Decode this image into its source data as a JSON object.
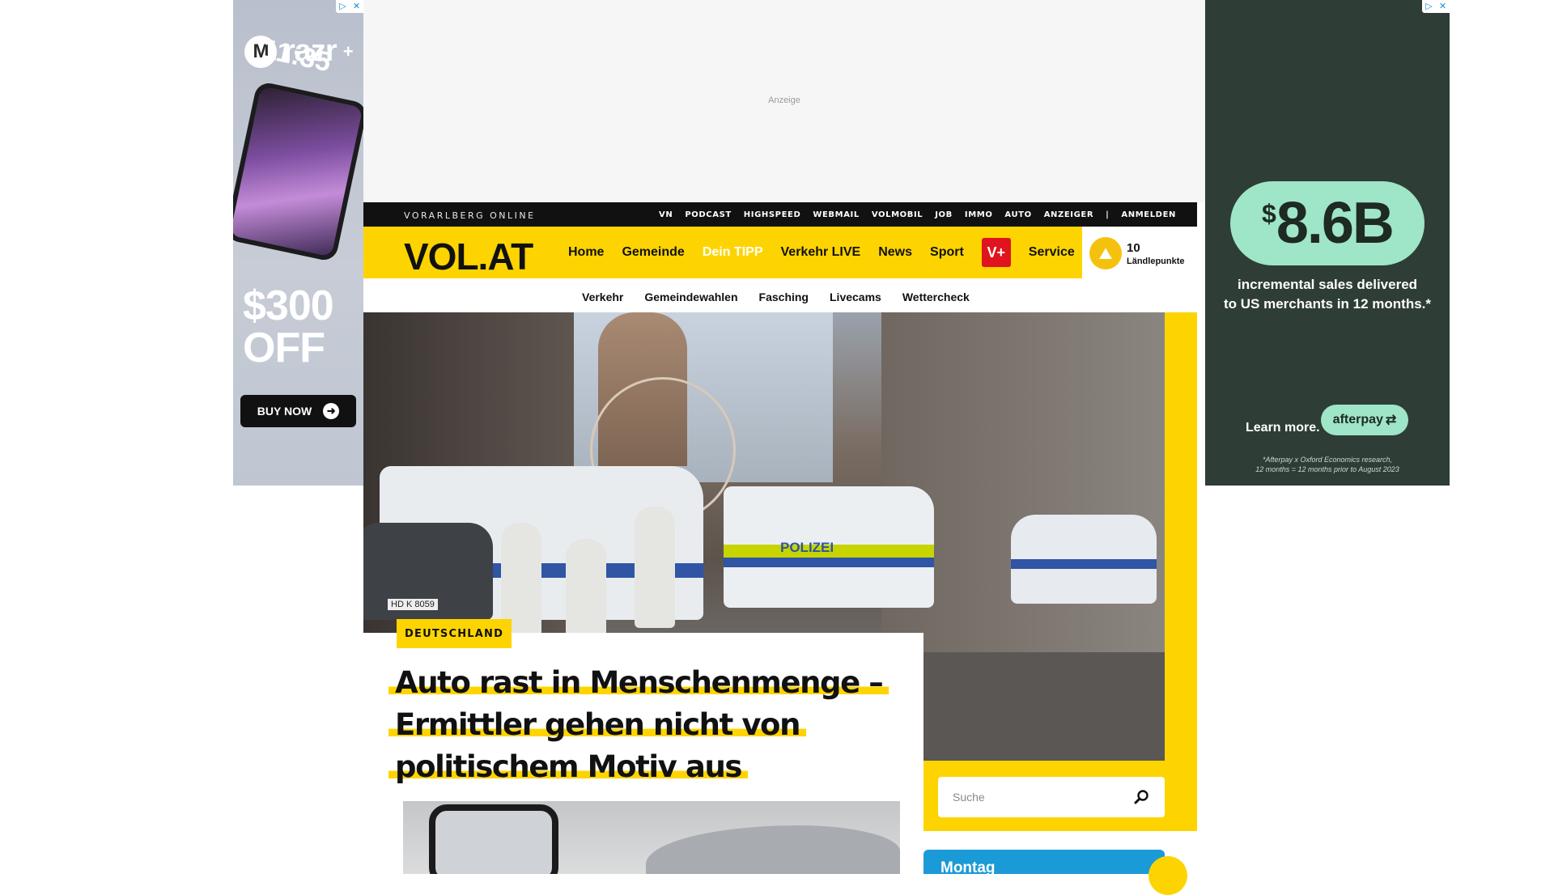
{
  "left_ad": {
    "brand": "razr",
    "brand_sup": "+",
    "phone_time": "11:35",
    "promo_line1": "$300",
    "promo_line2": "OFF",
    "cta": "BUY NOW"
  },
  "right_ad": {
    "currency": "$",
    "amount": "8.6B",
    "desc_line1": "incremental sales delivered",
    "desc_line2": "to US merchants in 12 months.*",
    "learn": "Learn more.",
    "brand": "afterpay",
    "foot_line1": "*Afterpay x Oxford Economics research,",
    "foot_line2": "12 months = 12 months prior to August 2023"
  },
  "top_ad": {
    "label": "Anzeige"
  },
  "topbar": {
    "site_name": "VORARLBERG ONLINE",
    "links": [
      "VN",
      "PODCAST",
      "HIGHSPEED",
      "WEBMAIL",
      "VOLMOBIL",
      "JOB",
      "IMMO",
      "AUTO",
      "ANZEIGER"
    ],
    "login": "ANMELDEN"
  },
  "mainnav": {
    "logo": "VOL.AT",
    "items": [
      "Home",
      "Gemeinde",
      "Dein TIPP",
      "Verkehr LIVE",
      "News",
      "Sport"
    ],
    "vplus": "V+",
    "service": "Service",
    "accent": "#fed400"
  },
  "points": {
    "value": "10",
    "label": "Ländlepunkte"
  },
  "subnav": {
    "items": [
      "Verkehr",
      "Gemeindewahlen",
      "Fasching",
      "Livecams",
      "Wettercheck"
    ]
  },
  "article": {
    "kicker": "DEUTSCHLAND",
    "headline_lines": [
      "Auto rast in Menschenmenge –",
      "Ermittler gehen nicht von",
      "politischem Motiv aus"
    ],
    "hero_text": "POLIZEI",
    "plate": "HD K 8059"
  },
  "search": {
    "placeholder": "Suche"
  },
  "weather": {
    "day": "Montag"
  }
}
